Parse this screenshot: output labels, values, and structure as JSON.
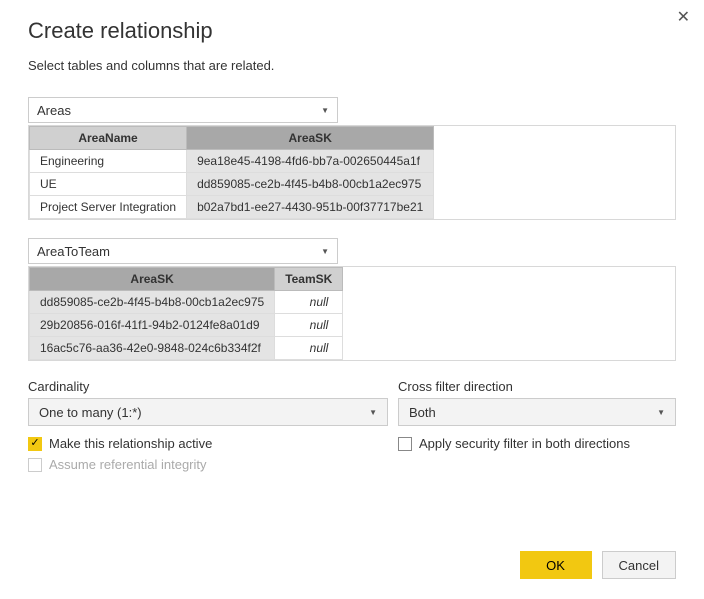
{
  "dialog": {
    "title": "Create relationship",
    "subtitle": "Select tables and columns that are related."
  },
  "table1": {
    "selected": "Areas",
    "columns": [
      {
        "name": "AreaName",
        "selected": false
      },
      {
        "name": "AreaSK",
        "selected": true
      }
    ],
    "rows": [
      [
        "Engineering",
        "9ea18e45-4198-4fd6-bb7a-002650445a1f"
      ],
      [
        "UE",
        "dd859085-ce2b-4f45-b4b8-00cb1a2ec975"
      ],
      [
        "Project Server Integration",
        "b02a7bd1-ee27-4430-951b-00f37717be21"
      ]
    ]
  },
  "table2": {
    "selected": "AreaToTeam",
    "columns": [
      {
        "name": "AreaSK",
        "selected": true
      },
      {
        "name": "TeamSK",
        "selected": false
      }
    ],
    "rows": [
      [
        "dd859085-ce2b-4f45-b4b8-00cb1a2ec975",
        "null"
      ],
      [
        "29b20856-016f-41f1-94b2-0124fe8a01d9",
        "null"
      ],
      [
        "16ac5c76-aa36-42e0-9848-024c6b334f2f",
        "null"
      ]
    ]
  },
  "cardinality": {
    "label": "Cardinality",
    "value": "One to many (1:*)"
  },
  "crossfilter": {
    "label": "Cross filter direction",
    "value": "Both"
  },
  "checks": {
    "active": "Make this relationship active",
    "assume": "Assume referential integrity",
    "security": "Apply security filter in both directions"
  },
  "buttons": {
    "ok": "OK",
    "cancel": "Cancel"
  }
}
